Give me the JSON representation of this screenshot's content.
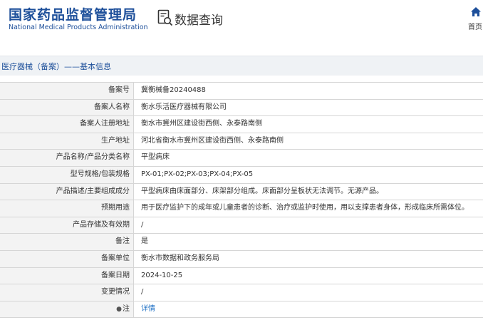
{
  "header": {
    "logo_cn": "国家药品监督管理局",
    "logo_en": "National Medical Products Administration",
    "query_title": "数据查询",
    "home_label": "首页"
  },
  "section": {
    "title": "医疗器械（备案）——基本信息"
  },
  "rows": [
    {
      "label": "备案号",
      "value": "冀衡械备20240488"
    },
    {
      "label": "备案人名称",
      "value": "衡水乐活医疗器械有限公司"
    },
    {
      "label": "备案人注册地址",
      "value": "衡水市冀州区建设街西侧、永泰路南侧"
    },
    {
      "label": "生产地址",
      "value": "河北省衡水市冀州区建设街西侧、永泰路南侧"
    },
    {
      "label": "产品名称/产品分类名称",
      "value": "平型病床"
    },
    {
      "label": "型号规格/包装规格",
      "value": "PX-01;PX-02;PX-03;PX-04;PX-05"
    },
    {
      "label": "产品描述/主要组成成分",
      "value": "平型病床由床面部分、床架部分组成。床面部分呈板状无法调节。无源产品。"
    },
    {
      "label": "预期用途",
      "value": "用于医疗监护下的成年或儿童患者的诊断、治疗或监护时使用，用以支撑患者身体，形成临床所需体位。"
    },
    {
      "label": "产品存储及有效期",
      "value": "/"
    },
    {
      "label": "备注",
      "value": "是"
    },
    {
      "label": "备案单位",
      "value": "衡水市数据和政务服务局"
    },
    {
      "label": "备案日期",
      "value": "2024-10-25"
    },
    {
      "label": "变更情况",
      "value": "/"
    },
    {
      "label": "注",
      "value": "详情"
    }
  ],
  "icons": {
    "home": "home-icon",
    "query": "search-document-icon",
    "pin": "pin-icon"
  },
  "colors": {
    "brand": "#1d4f9a",
    "link": "#1d6fc4",
    "label_bg": "#f3f3f3"
  }
}
